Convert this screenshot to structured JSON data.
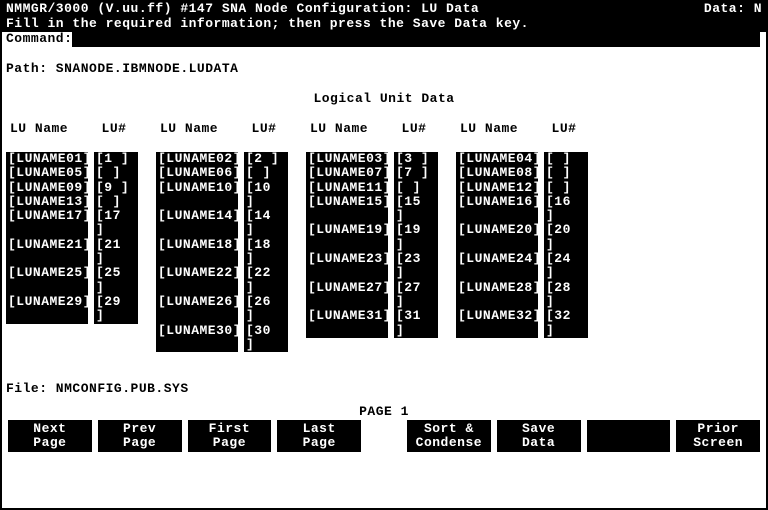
{
  "header": {
    "left": "NMMGR/3000 (V.uu.ff) #147 SNA Node Configuration: LU Data",
    "right": "Data: N",
    "instruction": "Fill in the required information; then press the Save Data key.",
    "command_label": "Command:"
  },
  "path_label": "Path: SNANODE.IBMNODE.LUDATA",
  "title": "Logical Unit Data",
  "col_headers": {
    "name": "LU Name",
    "num": "LU#"
  },
  "columns": [
    [
      {
        "name": "[LUNAME01]",
        "num": "[1  ]"
      },
      {
        "name": "[LUNAME05]",
        "num": "[   ]"
      },
      {
        "name": "[LUNAME09]",
        "num": "[9  ]"
      },
      {
        "name": "[LUNAME13]",
        "num": "[   ]"
      },
      {
        "name": "[LUNAME17]",
        "num": "[17 ]"
      },
      {
        "name": "[LUNAME21]",
        "num": "[21 ]"
      },
      {
        "name": "[LUNAME25]",
        "num": "[25 ]"
      },
      {
        "name": "[LUNAME29]",
        "num": "[29 ]"
      }
    ],
    [
      {
        "name": "[LUNAME02]",
        "num": "[2  ]"
      },
      {
        "name": "[LUNAME06]",
        "num": "[   ]"
      },
      {
        "name": "[LUNAME10]",
        "num": "[10 ]"
      },
      {
        "name": "[LUNAME14]",
        "num": "[14 ]"
      },
      {
        "name": "[LUNAME18]",
        "num": "[18 ]"
      },
      {
        "name": "[LUNAME22]",
        "num": "[22 ]"
      },
      {
        "name": "[LUNAME26]",
        "num": "[26 ]"
      },
      {
        "name": "[LUNAME30]",
        "num": "[30 ]"
      }
    ],
    [
      {
        "name": "[LUNAME03]",
        "num": "[3  ]"
      },
      {
        "name": "[LUNAME07]",
        "num": "[7  ]"
      },
      {
        "name": "[LUNAME11]",
        "num": "[   ]"
      },
      {
        "name": "[LUNAME15]",
        "num": "[15 ]"
      },
      {
        "name": "[LUNAME19]",
        "num": "[19 ]"
      },
      {
        "name": "[LUNAME23]",
        "num": "[23 ]"
      },
      {
        "name": "[LUNAME27]",
        "num": "[27 ]"
      },
      {
        "name": "[LUNAME31]",
        "num": "[31 ]"
      }
    ],
    [
      {
        "name": "[LUNAME04]",
        "num": "[   ]"
      },
      {
        "name": "[LUNAME08]",
        "num": "[   ]"
      },
      {
        "name": "[LUNAME12]",
        "num": "[   ]"
      },
      {
        "name": "[LUNAME16]",
        "num": "[16 ]"
      },
      {
        "name": "[LUNAME20]",
        "num": "[20 ]"
      },
      {
        "name": "[LUNAME24]",
        "num": "[24 ]"
      },
      {
        "name": "[LUNAME28]",
        "num": "[28 ]"
      },
      {
        "name": "[LUNAME32]",
        "num": "[32 ]"
      }
    ]
  ],
  "file_label": "File: NMCONFIG.PUB.SYS",
  "page_label": "PAGE 1",
  "fkeys": [
    {
      "l1": "Next",
      "l2": "Page"
    },
    {
      "l1": "Prev",
      "l2": "Page"
    },
    {
      "l1": "First",
      "l2": "Page"
    },
    {
      "l1": "Last",
      "l2": "Page"
    },
    null,
    {
      "l1": "Sort &",
      "l2": "Condense"
    },
    {
      "l1": "Save",
      "l2": "Data"
    },
    {
      "l1": "",
      "l2": ""
    },
    {
      "l1": "Prior",
      "l2": "Screen"
    }
  ]
}
